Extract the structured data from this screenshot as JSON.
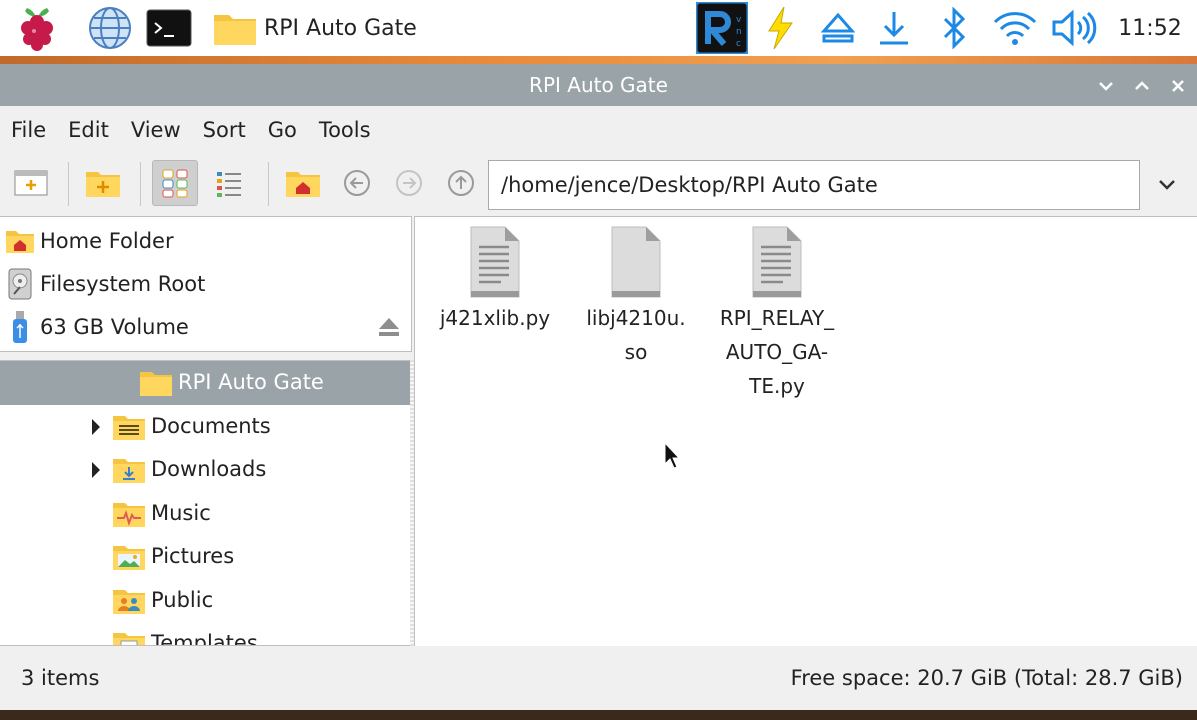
{
  "taskbar": {
    "active_window": "RPI Auto Gate",
    "clock": "11:52",
    "icons": [
      "raspberry-menu-icon",
      "globe-icon",
      "terminal-icon",
      "folder-icon",
      "vnc-icon",
      "bolt-icon",
      "eject-icon",
      "download-icon",
      "bluetooth-icon",
      "wifi-icon",
      "volume-icon"
    ]
  },
  "window": {
    "title": "RPI Auto Gate",
    "controls": [
      "chevron-down-icon",
      "chevron-up-icon",
      "close-icon"
    ]
  },
  "menu": {
    "file": "File",
    "edit": "Edit",
    "view": "View",
    "sort": "Sort",
    "go": "Go",
    "tools": "Tools"
  },
  "toolbar": {
    "path": "/home/jence/Desktop/RPI Auto Gate",
    "icons": [
      "new-window-icon",
      "new-folder-icon",
      "icon-view-icon",
      "list-view-icon",
      "home-icon",
      "back-icon",
      "forward-icon",
      "up-icon",
      "chevron-down-icon"
    ]
  },
  "places": {
    "home": "Home Folder",
    "root": "Filesystem Root",
    "volume": "63 GB Volume"
  },
  "tree": {
    "root": "RPI Auto Gate",
    "items": [
      "Documents",
      "Downloads",
      "Music",
      "Pictures",
      "Public",
      "Templates"
    ]
  },
  "files": [
    {
      "name": "j421xlib.py"
    },
    {
      "name": "libj4210u.so"
    },
    {
      "name": "RPI_RELAY_AUTO_GATE.py"
    }
  ],
  "file_display": {
    "f0": [
      "j421xlib.py"
    ],
    "f1": [
      "libj4210u.",
      "so"
    ],
    "f2": [
      "RPI_RELAY_",
      "AUTO_GA-",
      "TE.py"
    ]
  },
  "status": {
    "count": "3 items",
    "free": "Free space: 20.7 GiB (Total: 28.7 GiB)"
  },
  "colors": {
    "titlebar": "#9aa3a8",
    "folder": "#f5c542",
    "accent_blue": "#1e88e5"
  }
}
